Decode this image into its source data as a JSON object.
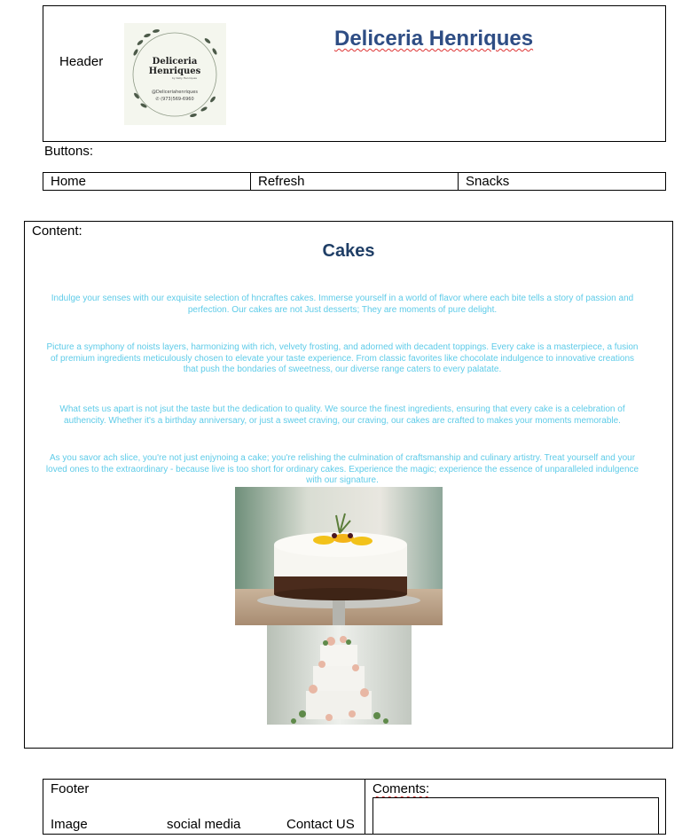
{
  "header": {
    "label": "Header",
    "title": "Deliceria Henriques",
    "logo": {
      "name_line1": "Deliceria",
      "name_line2": "Henriques",
      "byline": "by Kelly Henriques",
      "handle": "@Deliceriahenriques",
      "phone": "✆ (973)569-6960"
    }
  },
  "buttons": {
    "label": "Buttons:",
    "items": [
      "Home",
      "Refresh",
      "Snacks"
    ]
  },
  "content": {
    "label": "Content:",
    "title": "Cakes",
    "paragraphs": [
      "Indulge your senses with our exquisite selection of hncraftes cakes. Immerse yourself in a world of flavor where each bite tells a story of passion and perfection. Our cakes are not Just desserts; They are moments of pure delight.",
      "Picture a symphony of noists layers, harmonizing with rich, velvety frosting, and adorned with decadent toppings. Every cake is a masterpiece, a fusion of premium ingredients meticulously chosen to elevate your taste experience. From classic favorites like chocolate indulgence to innovative creations that push the bondaries of sweetness, our diverse range caters to every palatate.",
      "What sets us apart is not jsut the taste but the dedication to quality. We source the finest ingredients, ensuring that every cake is a celebration of authencity. Whether it's a birthday anniversary, or just a sweet craving, our craving, our cakes are crafted to makes your moments memorable.",
      "As you savor ach slice, you're not just enjynoing a cake; you're relishing the culmination of craftsmanship and culinary artistry. Treat yourself and your loved ones to the extraordinary - because live is too short for ordinary cakes. Experience the magic; experience the essence of unparalleled indulgence with our signature."
    ]
  },
  "footer": {
    "label": "Footer",
    "image_label": "Image",
    "social_label": "social media",
    "contact_label": "Contact US",
    "comments_label": "Coments:",
    "comments_value": ""
  },
  "colors": {
    "title_blue": "#2e4d84",
    "cakes_heading": "#1f3e66",
    "paragraph_cyan": "#5ecbe8"
  }
}
